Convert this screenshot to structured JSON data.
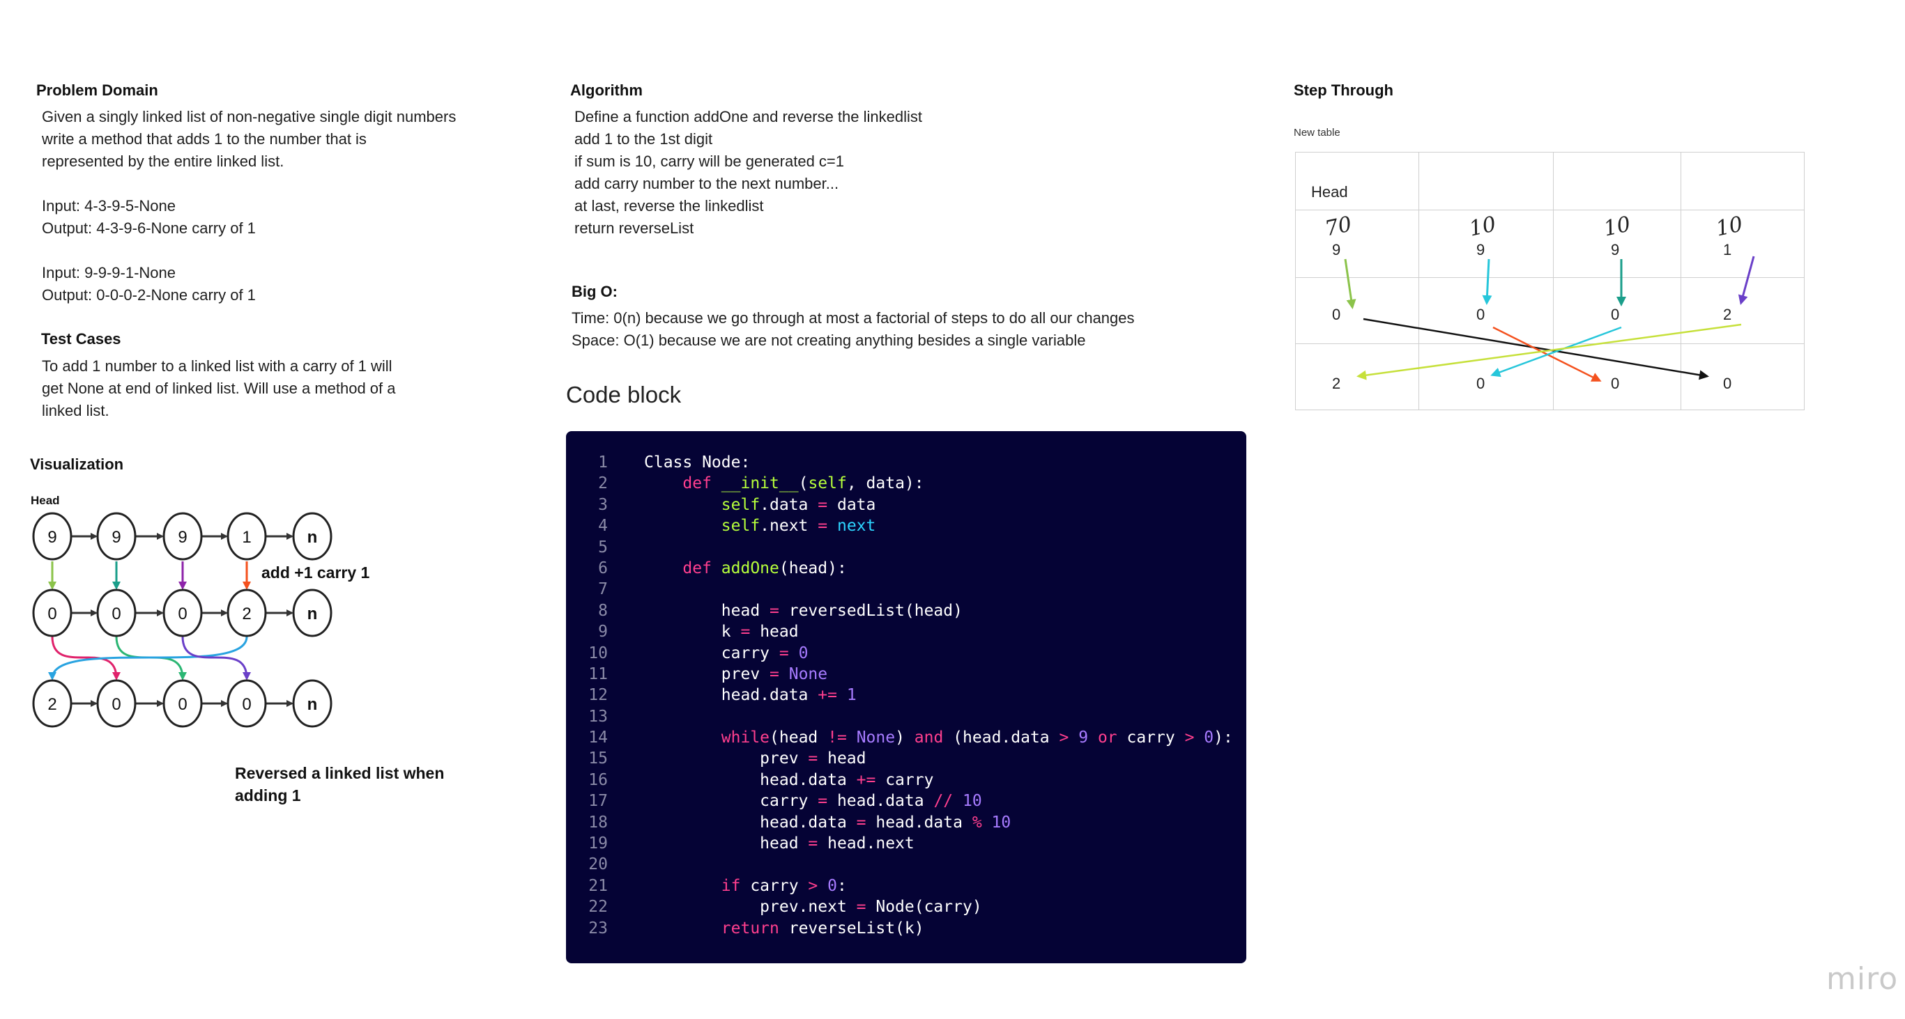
{
  "problem": {
    "title": "Problem Domain",
    "lines": [
      "Given a singly linked list of non-negative single digit numbers",
      "write a method that adds 1 to the number that is",
      "represented by the entire linked list.",
      "",
      "Input: 4-3-9-5-None",
      "Output: 4-3-9-6-None carry of 1",
      "",
      "Input: 9-9-9-1-None",
      "Output: 0-0-0-2-None carry of 1"
    ]
  },
  "tests": {
    "title": "Test Cases",
    "lines": [
      "To add 1 number to a linked list with a carry of 1 will",
      "get None at end of linked list. Will use a method of a",
      "linked list."
    ]
  },
  "algorithm": {
    "title": "Algorithm",
    "lines": [
      "Define a function addOne and reverse the linkedlist",
      "add 1 to the 1st digit",
      "if sum is 10, carry will be generated c=1",
      "add carry number to the next number...",
      "at last, reverse the linkedlist",
      "return reverseList"
    ]
  },
  "bigo": {
    "title": "Big O:",
    "lines": [
      "Time: 0(n) because we go through at most a factorial of steps to do all our changes",
      "Space: O(1) because we are not creating anything besides a single variable"
    ]
  },
  "visualization": {
    "title": "Visualization",
    "head_label": "Head",
    "row1": [
      "9",
      "9",
      "9",
      "1",
      "n"
    ],
    "row2": [
      "0",
      "0",
      "0",
      "2",
      "n"
    ],
    "row3": [
      "2",
      "0",
      "0",
      "0",
      "n"
    ],
    "add_label": "add +1 carry 1",
    "caption_line1": "Reversed a linked list when",
    "caption_line2": "adding 1",
    "colors": {
      "green": "#8bc34a",
      "teal": "#1a9e8a",
      "purple": "#8e24aa",
      "red": "#f4511e",
      "blue": "#29a3e0",
      "pink": "#e0226b",
      "darkgreen": "#2bb673",
      "violet": "#6a3fc8"
    }
  },
  "code": {
    "title": "Code block",
    "lines": [
      [
        [
          "Class Node:",
          "code"
        ]
      ],
      [
        [
          "    ",
          "code"
        ],
        [
          "def",
          "t-kw"
        ],
        [
          " ",
          "code"
        ],
        [
          "__init__",
          "t-fn"
        ],
        [
          "(",
          "code"
        ],
        [
          "self",
          "t-sf"
        ],
        [
          ", data):",
          "code"
        ]
      ],
      [
        [
          "        ",
          "code"
        ],
        [
          "self",
          "t-sf"
        ],
        [
          ".data ",
          "code"
        ],
        [
          "=",
          "t-op"
        ],
        [
          " data",
          "code"
        ]
      ],
      [
        [
          "        ",
          "code"
        ],
        [
          "self",
          "t-sf"
        ],
        [
          ".next ",
          "code"
        ],
        [
          "=",
          "t-op"
        ],
        [
          " ",
          "code"
        ],
        [
          "next",
          "t-nx"
        ]
      ],
      [
        [
          "",
          "code"
        ]
      ],
      [
        [
          "    ",
          "code"
        ],
        [
          "def",
          "t-kw"
        ],
        [
          " ",
          "code"
        ],
        [
          "addOne",
          "t-fn"
        ],
        [
          "(head):",
          "code"
        ]
      ],
      [
        [
          "",
          "code"
        ]
      ],
      [
        [
          "        head ",
          "code"
        ],
        [
          "=",
          "t-op"
        ],
        [
          " reversedList(head)",
          "code"
        ]
      ],
      [
        [
          "        k ",
          "code"
        ],
        [
          "=",
          "t-op"
        ],
        [
          " head",
          "code"
        ]
      ],
      [
        [
          "        carry ",
          "code"
        ],
        [
          "=",
          "t-op"
        ],
        [
          " ",
          "code"
        ],
        [
          "0",
          "t-num"
        ]
      ],
      [
        [
          "        prev ",
          "code"
        ],
        [
          "=",
          "t-op"
        ],
        [
          " ",
          "code"
        ],
        [
          "None",
          "t-cst"
        ]
      ],
      [
        [
          "        head.data ",
          "code"
        ],
        [
          "+=",
          "t-op"
        ],
        [
          " ",
          "code"
        ],
        [
          "1",
          "t-num"
        ]
      ],
      [
        [
          "",
          "code"
        ]
      ],
      [
        [
          "        ",
          "code"
        ],
        [
          "while",
          "t-kw"
        ],
        [
          "(head ",
          "code"
        ],
        [
          "!=",
          "t-op"
        ],
        [
          " ",
          "code"
        ],
        [
          "None",
          "t-cst"
        ],
        [
          ") ",
          "code"
        ],
        [
          "and",
          "t-kw"
        ],
        [
          " (head.data ",
          "code"
        ],
        [
          ">",
          "t-op"
        ],
        [
          " ",
          "code"
        ],
        [
          "9",
          "t-num"
        ],
        [
          " ",
          "code"
        ],
        [
          "or",
          "t-kw"
        ],
        [
          " carry ",
          "code"
        ],
        [
          ">",
          "t-op"
        ],
        [
          " ",
          "code"
        ],
        [
          "0",
          "t-num"
        ],
        [
          "):",
          "code"
        ]
      ],
      [
        [
          "            prev ",
          "code"
        ],
        [
          "=",
          "t-op"
        ],
        [
          " head",
          "code"
        ]
      ],
      [
        [
          "            head.data ",
          "code"
        ],
        [
          "+=",
          "t-op"
        ],
        [
          " carry",
          "code"
        ]
      ],
      [
        [
          "            carry ",
          "code"
        ],
        [
          "=",
          "t-op"
        ],
        [
          " head.data ",
          "code"
        ],
        [
          "//",
          "t-op"
        ],
        [
          " ",
          "code"
        ],
        [
          "10",
          "t-num"
        ]
      ],
      [
        [
          "            head.data ",
          "code"
        ],
        [
          "=",
          "t-op"
        ],
        [
          " head.data ",
          "code"
        ],
        [
          "%",
          "t-op"
        ],
        [
          " ",
          "code"
        ],
        [
          "10",
          "t-num"
        ]
      ],
      [
        [
          "            head ",
          "code"
        ],
        [
          "=",
          "t-op"
        ],
        [
          " head.next",
          "code"
        ]
      ],
      [
        [
          "",
          "code"
        ]
      ],
      [
        [
          "        ",
          "code"
        ],
        [
          "if",
          "t-kw"
        ],
        [
          " carry ",
          "code"
        ],
        [
          ">",
          "t-op"
        ],
        [
          " ",
          "code"
        ],
        [
          "0",
          "t-num"
        ],
        [
          ":",
          "code"
        ]
      ],
      [
        [
          "            prev.next ",
          "code"
        ],
        [
          "=",
          "t-op"
        ],
        [
          " Node(carry)",
          "code"
        ]
      ],
      [
        [
          "        ",
          "code"
        ],
        [
          "return",
          "t-kw"
        ],
        [
          " reverseList(k)",
          "code"
        ]
      ]
    ]
  },
  "step": {
    "title": "Step Through",
    "table_label": "New table",
    "header": "Head",
    "row_orig": [
      "9",
      "9",
      "9",
      "1"
    ],
    "row_orig_scribble": [
      "70",
      "10",
      "10",
      "10"
    ],
    "row_added": [
      "0",
      "0",
      "0",
      "2"
    ],
    "row_reversed": [
      "2",
      "0",
      "0",
      "0"
    ],
    "colors": {
      "c1": "#8bc34a",
      "c2": "#26c6da",
      "c3": "#1a9e8a",
      "c4": "#6a3fc8",
      "black": "#111111",
      "red": "#f4511e",
      "cyan": "#26c6da",
      "lime": "#c6e03a"
    }
  },
  "brand": "miro"
}
